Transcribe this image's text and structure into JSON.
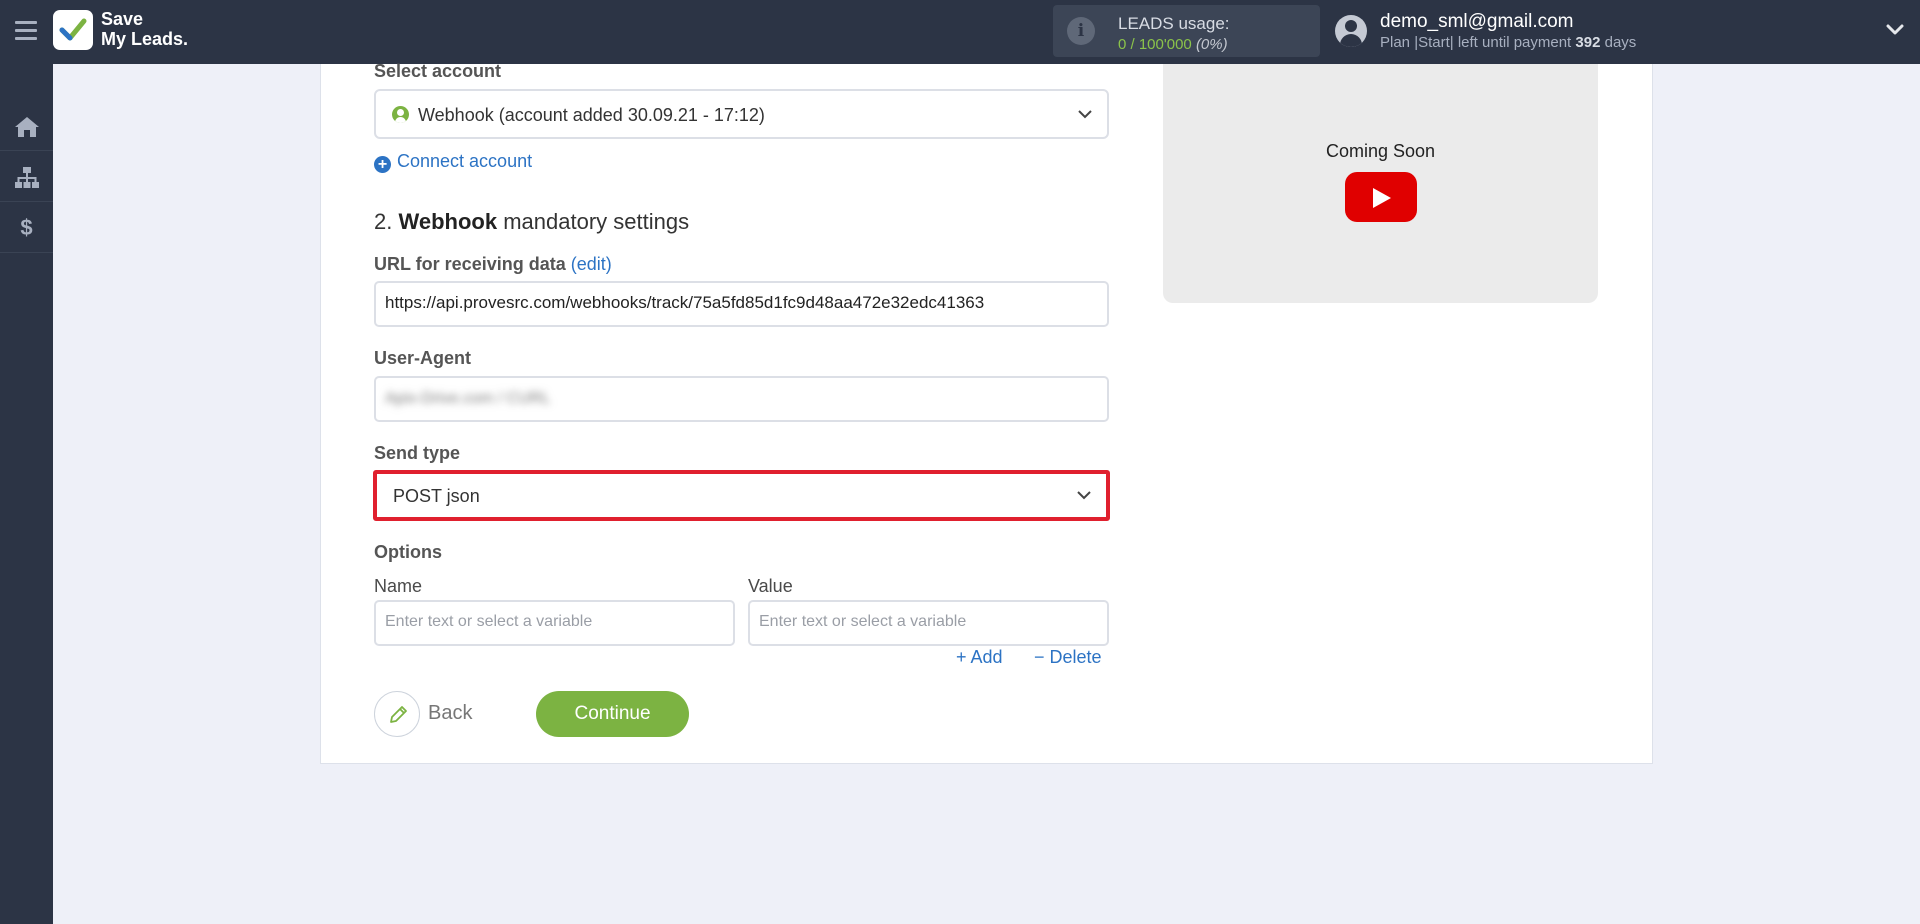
{
  "app": {
    "logo_line1": "Save",
    "logo_line2": "My Leads."
  },
  "usage": {
    "title": "LEADS usage:",
    "value": "0 / 100'000",
    "percent": "(0%)"
  },
  "user": {
    "email": "demo_sml@gmail.com",
    "plan_prefix": "Plan |Start| left until payment",
    "days": "392",
    "days_suffix": "days"
  },
  "sidebar": {
    "items": [
      "home-icon",
      "sitemap-icon",
      "dollar-icon"
    ],
    "dollar": "$"
  },
  "form": {
    "select_account_label": "Select account",
    "account_value": "Webhook (account added 30.09.21 - 17:12)",
    "connect_account": "Connect account",
    "section_number": "2.",
    "section_bold": "Webhook",
    "section_rest": "mandatory settings",
    "url_label": "URL for receiving data",
    "url_edit": "(edit)",
    "url_value": "https://api.provesrc.com/webhooks/track/75a5fd85d1fc9d48aa472e32edc41363",
    "user_agent_label": "User-Agent",
    "user_agent_value": "Apix-Drive.com / CURL",
    "send_type_label": "Send type",
    "send_type_value": "POST json",
    "options_label": "Options",
    "name_label": "Name",
    "value_label": "Value",
    "name_placeholder": "Enter text or select a variable",
    "value_placeholder": "Enter text or select a variable",
    "add": "+ Add",
    "delete": "− Delete",
    "back": "Back",
    "continue": "Continue"
  },
  "video": {
    "coming_soon": "Coming Soon"
  },
  "colors": {
    "topbar": "#2c3445",
    "accent_green": "#7cb342",
    "link_blue": "#2c73c4",
    "highlight_red": "#e0202e",
    "youtube_red": "#e00000"
  }
}
